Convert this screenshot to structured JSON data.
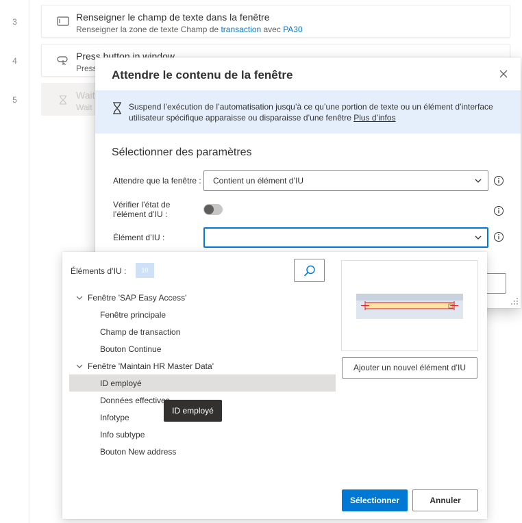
{
  "line_numbers": [
    "3",
    "4",
    "5"
  ],
  "steps": [
    {
      "title": "Renseigner le champ de texte dans la fenêtre",
      "sub_prefix": "Renseigner la zone de texte Champ de ",
      "sub_link1": "transaction",
      "sub_mid": " avec ",
      "sub_link2": "PA30",
      "icon": "textbox-icon"
    },
    {
      "title": "Press button in window",
      "sub": "Press",
      "icon": "press-button-icon"
    },
    {
      "title": "Wait",
      "sub": "Wait",
      "icon": "hourglass-icon"
    }
  ],
  "dialog": {
    "title": "Attendre le contenu de la fenêtre",
    "info_text": "Suspend l’exécution de l’automatisation jusqu’à ce qu’une portion de texte ou un élément d’interface utilisateur spécifique apparaisse ou disparaisse d’une fenêtre ",
    "info_link": "Plus d’infos",
    "section_heading": "Sélectionner des paramètres",
    "field_wait_label": "Attendre que la fenêtre :",
    "field_wait_value": "Contient un élément d’IU",
    "field_check_label_1": "Vérifier l’état de",
    "field_check_label_2": "l’élément d’IU :",
    "field_check_state": "off",
    "field_element_label": "Élément d’IU :",
    "field_element_value": ""
  },
  "picker": {
    "label": "Éléments d’IU :",
    "count": "10",
    "tree": [
      {
        "label": "Fenêtre 'SAP Easy Access'",
        "level": 0,
        "expanded": true
      },
      {
        "label": "Fenêtre principale",
        "level": 1
      },
      {
        "label": "Champ de transaction",
        "level": 1
      },
      {
        "label": "Bouton Continue",
        "level": 1
      },
      {
        "label": "Fenêtre 'Maintain HR Master Data'",
        "level": 0,
        "expanded": true
      },
      {
        "label": "ID employé",
        "level": 1,
        "selected": true
      },
      {
        "label": "Données effectives",
        "level": 1
      },
      {
        "label": "Infotype",
        "level": 1
      },
      {
        "label": "Info subtype",
        "level": 1
      },
      {
        "label": "Bouton New address",
        "level": 1
      }
    ],
    "tooltip": "ID employé",
    "add_button": "Ajouter un nouvel élément d’IU",
    "select_button": "Sélectionner",
    "cancel_button": "Annuler"
  },
  "colors": {
    "accent": "#0078d4",
    "info_bg": "#e5effb",
    "selected_row": "#e1dfdd",
    "tooltip_bg": "#323130"
  }
}
